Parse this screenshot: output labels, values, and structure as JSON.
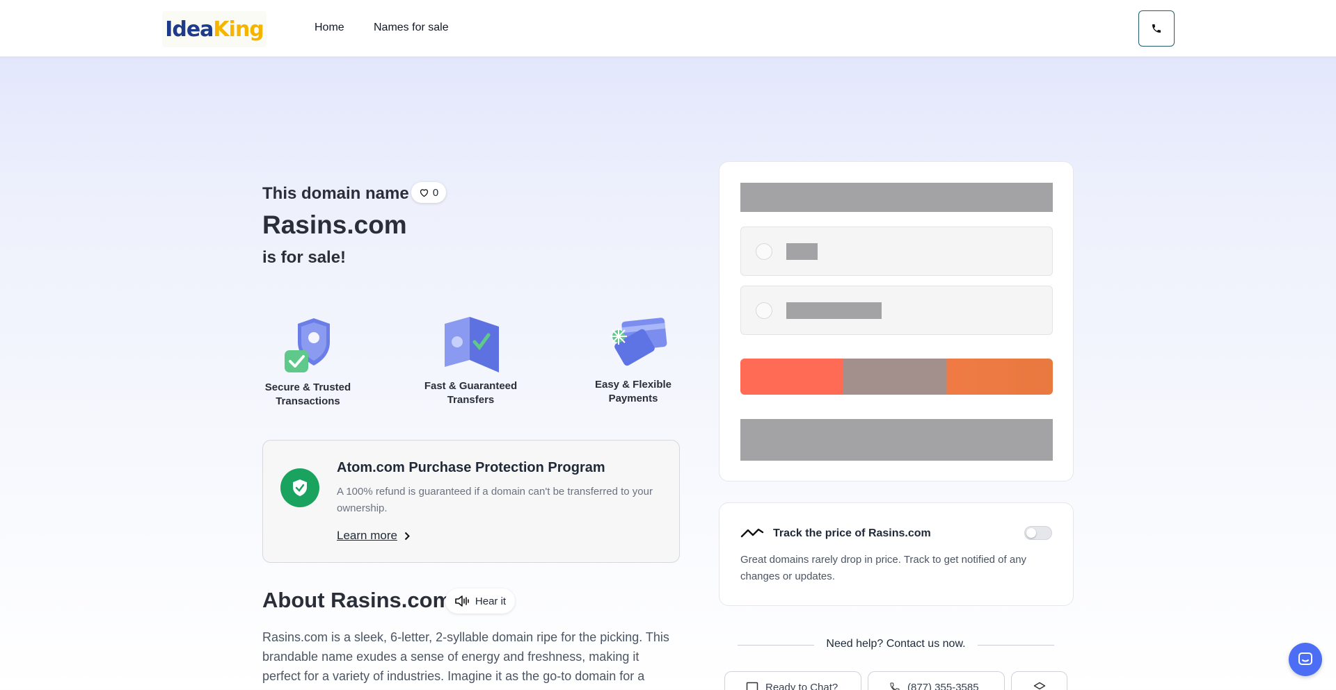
{
  "header": {
    "logo": {
      "part1": "Idea",
      "part2": "King"
    },
    "nav": {
      "home": "Home",
      "names_for_sale": "Names for sale"
    },
    "phone_icon": "phone-icon"
  },
  "hero": {
    "line1": "This domain name",
    "favorites_count": "0",
    "domain": "Rasins.com",
    "line3": "is for sale!"
  },
  "features": [
    {
      "label": "Secure & Trusted Transactions",
      "icon": "shield-check-icon"
    },
    {
      "label": "Fast & Guaranteed Transfers",
      "icon": "transfer-icon"
    },
    {
      "label": "Easy & Flexible Payments",
      "icon": "payment-cards-icon"
    }
  ],
  "protection": {
    "title": "Atom.com Purchase Protection Program",
    "description": "A 100% refund is guaranteed if a domain can't be transferred to your ownership.",
    "link": "Learn more"
  },
  "about": {
    "title": "About Rasins.com",
    "hear_label": "Hear it",
    "text": "Rasins.com is a sleek, 6-letter, 2-syllable domain ripe for the picking. This brandable name exudes a sense of energy and freshness, making it perfect for a variety of industries. Imagine it as the go-to domain for a trendy food"
  },
  "track": {
    "title": "Track the price of Rasins.com",
    "description": "Great domains rarely drop in price. Track to get notified of any changes or updates.",
    "enabled": false
  },
  "help": {
    "title": "Need help? Contact us now.",
    "chat_label": "Ready to Chat?",
    "phone_label": "(877) 355-3585"
  },
  "colors": {
    "brand_blue": "#1e3a8a",
    "brand_yellow": "#f5b400",
    "protect_green": "#1aa35f",
    "cta_orange": "#ff6b55",
    "chat_blue": "#4c6ef5"
  }
}
